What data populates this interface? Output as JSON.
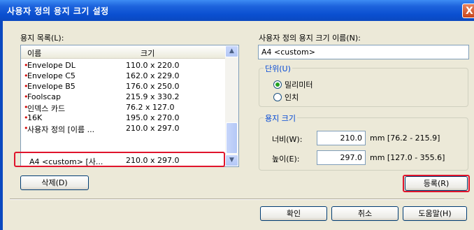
{
  "window": {
    "title": "사용자 정의 용지 크기 설정",
    "close_glyph": "X"
  },
  "paper_list": {
    "label": "용지 목록(L):",
    "columns": [
      "이름",
      "크기"
    ],
    "rows": [
      {
        "name": "Envelope DL",
        "size": "110.0 x 220.0",
        "marked": true
      },
      {
        "name": "Envelope C5",
        "size": "162.0 x 229.0",
        "marked": true
      },
      {
        "name": "Envelope B5",
        "size": "176.0 x 250.0",
        "marked": true
      },
      {
        "name": "Foolscap",
        "size": "215.9 x 330.2",
        "marked": true
      },
      {
        "name": "인덱스 카드",
        "size": "76.2 x 127.0",
        "marked": true
      },
      {
        "name": "16K",
        "size": "195.0 x 270.0",
        "marked": true
      },
      {
        "name": "사용자 정의 [이름 ...",
        "size": "210.0 x 297.0",
        "marked": true
      },
      {
        "name": "A4 <custom> [사...",
        "size": "210.0 x 297.0",
        "marked": false,
        "selected": true
      }
    ],
    "delete_button": "삭제(D)"
  },
  "custom_name": {
    "label": "사용자 정의 용지 크기 이름(N):",
    "value": "A4 <custom>"
  },
  "units": {
    "group_title": "단위(U)",
    "options": [
      {
        "label": "밀리미터",
        "checked": true
      },
      {
        "label": "인치",
        "checked": false
      }
    ]
  },
  "paper_size": {
    "group_title": "용지 크기",
    "width": {
      "label": "너비(W):",
      "value": "210.0",
      "range": "mm [76.2 - 215.9]"
    },
    "height": {
      "label": "높이(E):",
      "value": "297.0",
      "range": "mm [127.0 - 355.6]"
    }
  },
  "register_button": "등록(R)",
  "footer": {
    "ok": "확인",
    "cancel": "취소",
    "help": "도움말(H)"
  },
  "colors": {
    "highlight": "#e0142c",
    "titlebar": "#0b49c0",
    "group_title": "#0046d5"
  }
}
